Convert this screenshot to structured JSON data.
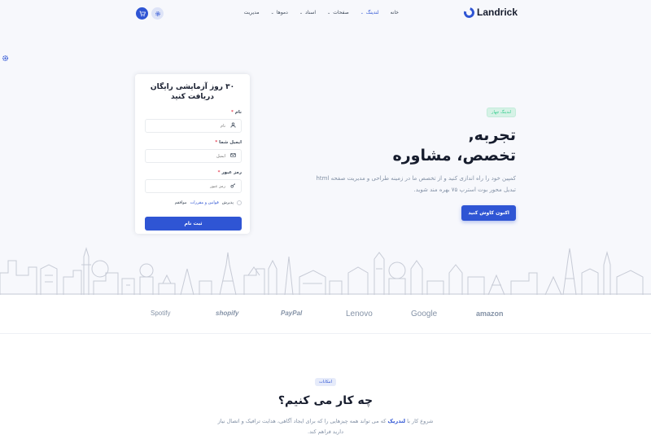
{
  "nav": {
    "logo_text": "Landrick",
    "menu": [
      {
        "label": "خانه",
        "has_chevron": false,
        "active": false
      },
      {
        "label": "لندینگ",
        "has_chevron": true,
        "active": true
      },
      {
        "label": "صفحات",
        "has_chevron": true,
        "active": false
      },
      {
        "label": "اسناد",
        "has_chevron": true,
        "active": false
      },
      {
        "label": "دموها",
        "has_chevron": true,
        "active": false
      },
      {
        "label": "مدیریت",
        "has_chevron": false,
        "active": false
      }
    ],
    "icons": [
      "cart-icon",
      "gear-icon"
    ]
  },
  "signup": {
    "title": "۳۰ روز آزمایشی رایگان دریافت کنید",
    "name_label": "نام",
    "name_placeholder": "نام",
    "email_label": "ایمیل شما",
    "email_placeholder": "ایمیل",
    "password_label": "رمز عبور",
    "password_placeholder": "رمز عبور",
    "terms_prefix": "پذیرش",
    "terms_link": "قوانین و مقررات",
    "terms_suffix": "موافقم",
    "submit_label": "ثبت نام"
  },
  "hero": {
    "badge": "لندینگ چهار",
    "headline_line1": "تجربه,",
    "headline_line2": "تخصص، مشاوره",
    "description": "کمپین خود را راه اندازی کنید و از تخصص ما در زمینه طراحی و مدیریت صفحه html تبدیل محور بوت استرپ ۷۵ بهره مند شوید.",
    "cta_label": "اکنون کاوش کنید"
  },
  "brands": [
    "Spotify",
    "shopify",
    "PayPal",
    "Lenovo",
    "Google",
    "amazon"
  ],
  "features": {
    "tag": "امکانات",
    "title": "چه کار می کنیم؟",
    "desc_prefix": "شروع کار با",
    "desc_highlight": "لندریک",
    "desc_suffix": "که می تواند همه چیزهایی را که برای ایجاد آگاهی، هدایت ترافیک و اتصال نیاز دارید فراهم کند."
  },
  "colors": {
    "primary": "#2f55d4",
    "success": "#2eca8b",
    "muted": "#8492a6",
    "hero_bg": "#f7f8fc"
  }
}
